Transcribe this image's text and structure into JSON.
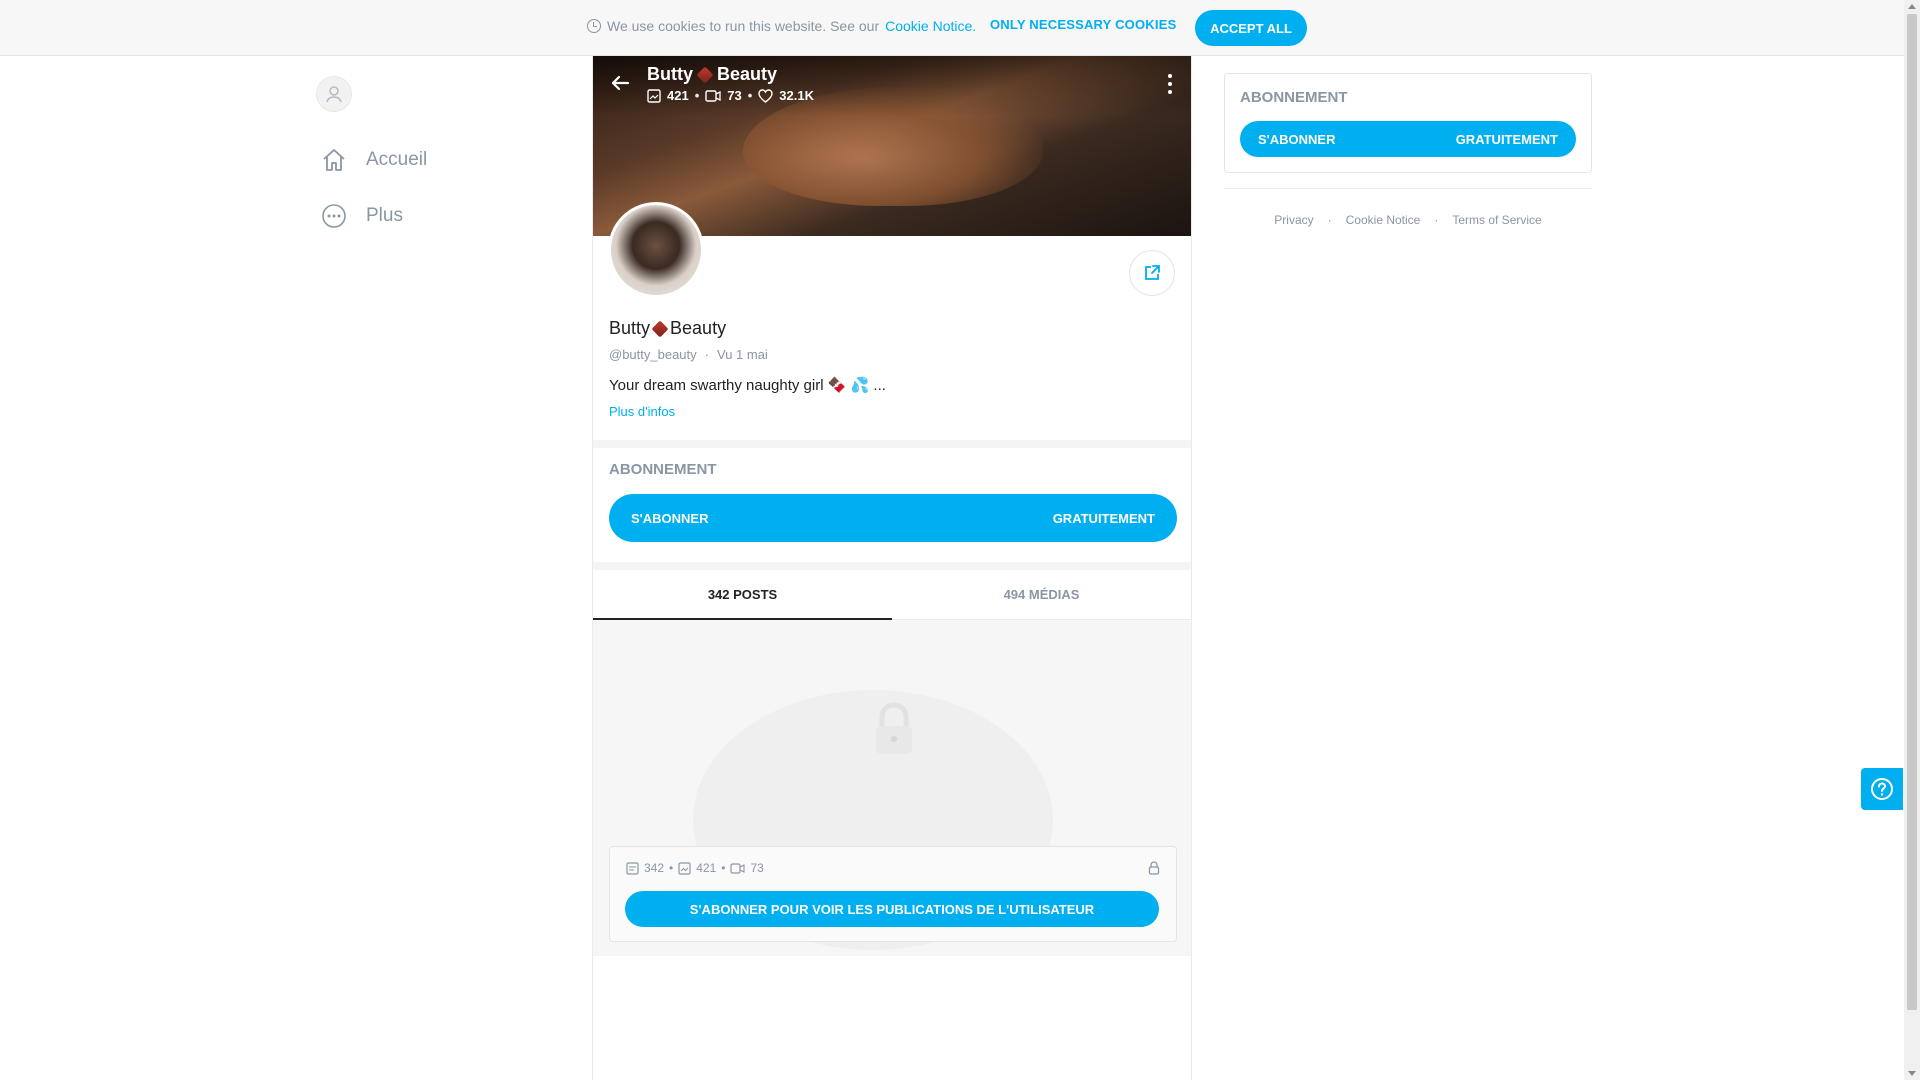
{
  "cookie_bar": {
    "message": "We use cookies to run this website. See our",
    "link": "Cookie Notice.",
    "necessary_label": "ONLY NECESSARY COOKIES",
    "accept_label": "ACCEPT ALL"
  },
  "nav": {
    "items": [
      {
        "label": "Accueil",
        "icon": "home-icon"
      },
      {
        "label": "Plus",
        "icon": "more-dots-icon"
      }
    ]
  },
  "profile": {
    "name_part1": "Butty",
    "name_part2": "Beauty",
    "photos_count": "421",
    "videos_count": "73",
    "likes_count": "32.1K",
    "handle": "@butty_beauty",
    "seen": "Vu  1 mai",
    "bio": "Your dream swarthy naughty girl 🍫 💦 ...",
    "more_info": "Plus d'infos"
  },
  "subscription": {
    "title": "ABONNEMENT",
    "button_left": "S'ABONNER",
    "button_right": "GRATUITEMENT"
  },
  "tabs": [
    {
      "label": "342 POSTS",
      "active": true
    },
    {
      "label": "494 MÉDIAS",
      "active": false
    }
  ],
  "locked": {
    "posts": "342",
    "photos": "421",
    "videos": "73",
    "button": "S'ABONNER POUR VOIR LES PUBLICATIONS DE L'UTILISATEUR"
  },
  "right": {
    "title": "ABONNEMENT",
    "button_left": "S'ABONNER",
    "button_right": "GRATUITEMENT",
    "footer": [
      "Privacy",
      "Cookie Notice",
      "Terms of Service"
    ]
  },
  "colors": {
    "accent": "#00aff0",
    "muted": "#8a96a3"
  }
}
